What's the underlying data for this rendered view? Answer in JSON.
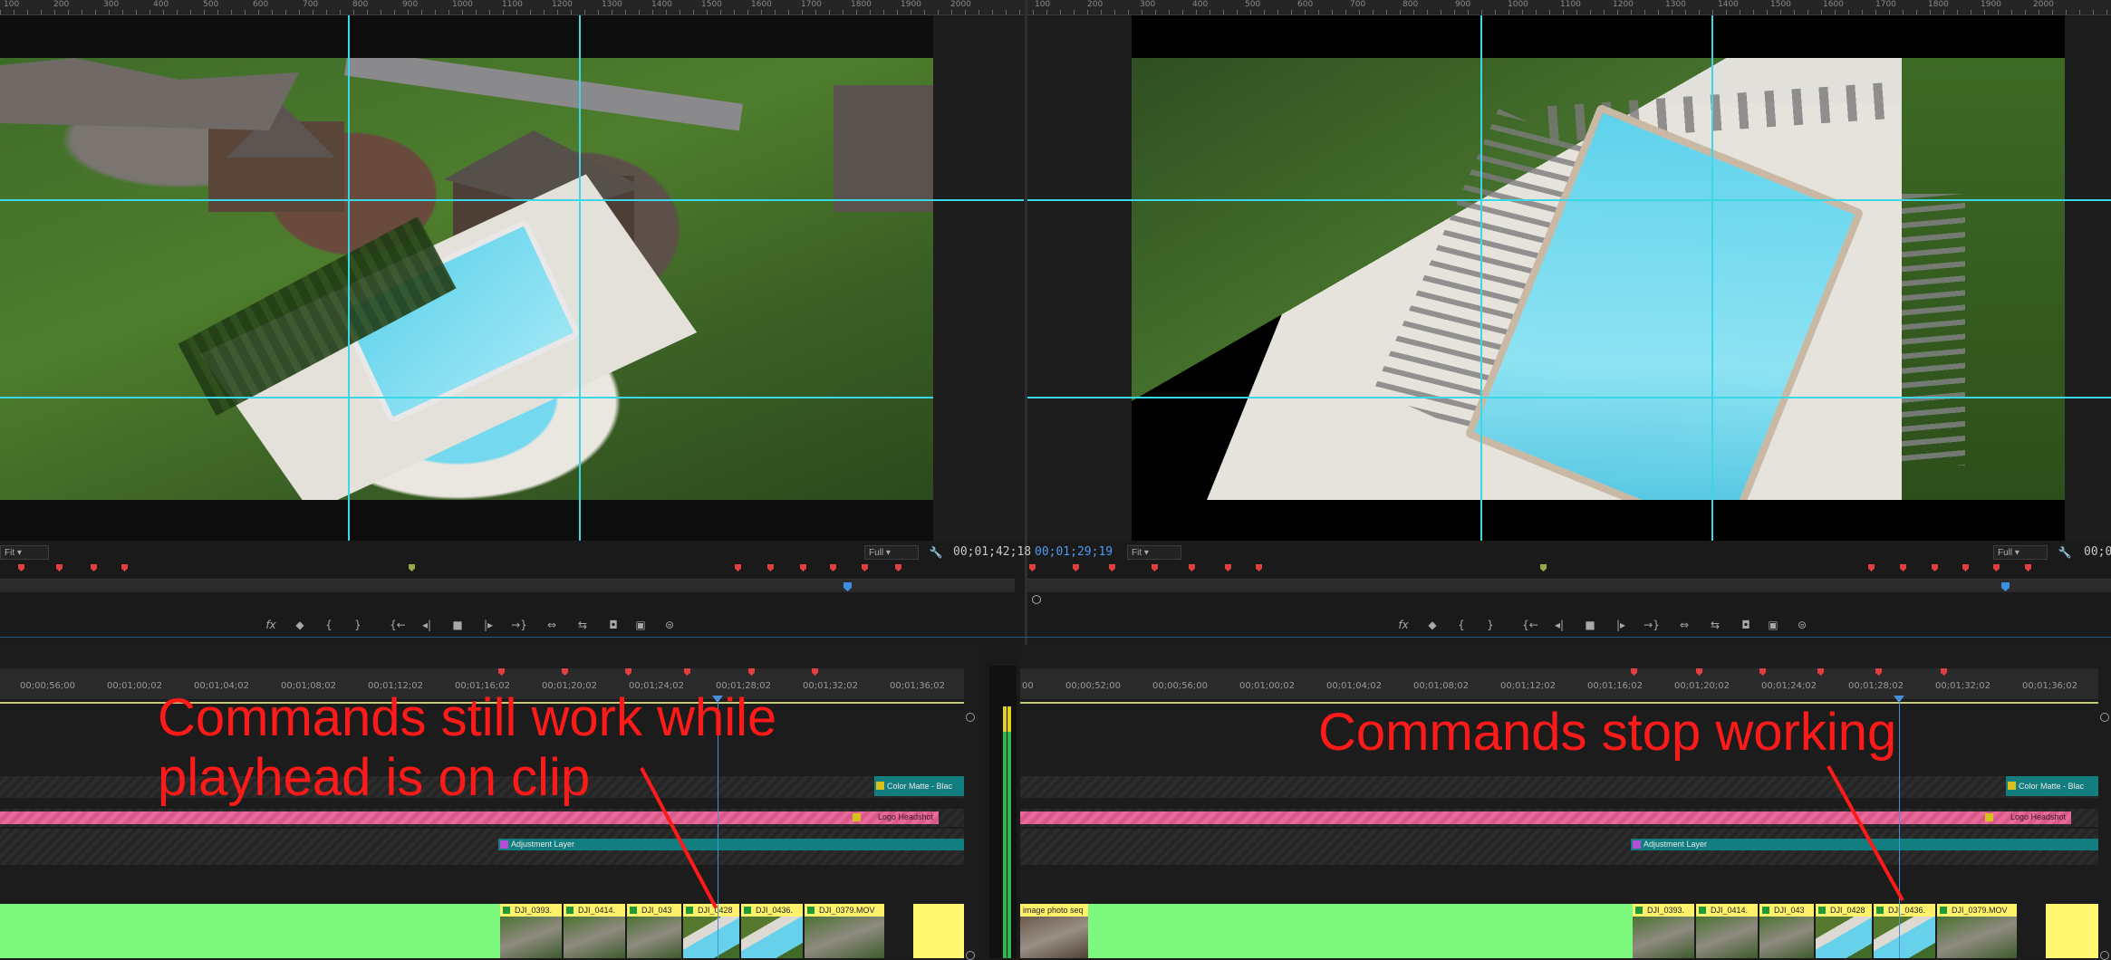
{
  "ruler": {
    "labels_left": [
      "100",
      "200",
      "300",
      "400",
      "500",
      "600",
      "700",
      "800",
      "900",
      "1000",
      "1100",
      "1200",
      "1300",
      "1400",
      "1500",
      "1600",
      "1700",
      "1800",
      "1900",
      "2000"
    ],
    "labels_right": [
      "100",
      "200",
      "300",
      "400",
      "500",
      "600",
      "700",
      "800",
      "900",
      "1000",
      "1100",
      "1200",
      "1300",
      "1400",
      "1500",
      "1600",
      "1700",
      "1800",
      "1900",
      "2000"
    ]
  },
  "source_monitor": {
    "fit_select": "Fit",
    "quality_select": "Full",
    "timecode": "00;01;42;18"
  },
  "program_monitor": {
    "timecode": "00;01;29;19",
    "fit_select": "Fit",
    "quality_select": "Full",
    "timecode_right": "00;0"
  },
  "transport_icons": [
    "fx-icon",
    "marker-icon",
    "mark-in-icon",
    "mark-out-icon",
    "go-to-in-icon",
    "step-back-icon",
    "stop-icon",
    "step-forward-icon",
    "go-to-out-icon",
    "insert-icon",
    "overwrite-icon",
    "export-frame-icon",
    "button-editor-icon",
    "settings-icon"
  ],
  "timeline_left": {
    "ruler_labels": [
      "00;00;56;00",
      "00;01;00;02",
      "00;01;04;02",
      "00;01;08;02",
      "00;01;12;02",
      "00;01;16;02",
      "00;01;20;02",
      "00;01;24;02",
      "00;01;28;02",
      "00;01;32;02",
      "00;01;36;02"
    ],
    "clips": {
      "color_matte": "Color Matte - Blac",
      "logo_headshot": "Logo Headshot",
      "adjustment_layer": "Adjustment Layer",
      "videos": [
        "DJI_0393.",
        "DJI_0414.",
        "DJI_043",
        "DJI_0428",
        "DJI_0436.",
        "DJI_0379.MOV"
      ]
    }
  },
  "timeline_right": {
    "ruler_labels": [
      "00",
      "00;00;52;00",
      "00;00;56;00",
      "00;01;00;02",
      "00;01;04;02",
      "00;01;08;02",
      "00;01;12;02",
      "00;01;16;02",
      "00;01;20;02",
      "00;01;24;02",
      "00;01;28;02",
      "00;01;32;02",
      "00;01;36;02"
    ],
    "clips": {
      "color_matte": "Color Matte - Blac",
      "logo_headshot": "Logo Headshot",
      "adjustment_layer": "Adjustment Layer",
      "image_seq": "image photo seq",
      "videos": [
        "DJI_0393.",
        "DJI_0414.",
        "DJI_043",
        "DJI_0428",
        "DJI_0436.",
        "DJI_0379.MOV"
      ]
    }
  },
  "annotations": {
    "left": "Commands still work while\nplayhead is on clip",
    "right": "Commands stop working"
  },
  "colors": {
    "annotation": "#ff1a1a",
    "guide": "#3ad8e6",
    "marker": "#e04040",
    "clip_green": "#7dfa7d",
    "clip_yellow": "#fff26a",
    "clip_pink": "#e86a9a",
    "clip_teal": "#137e80"
  }
}
